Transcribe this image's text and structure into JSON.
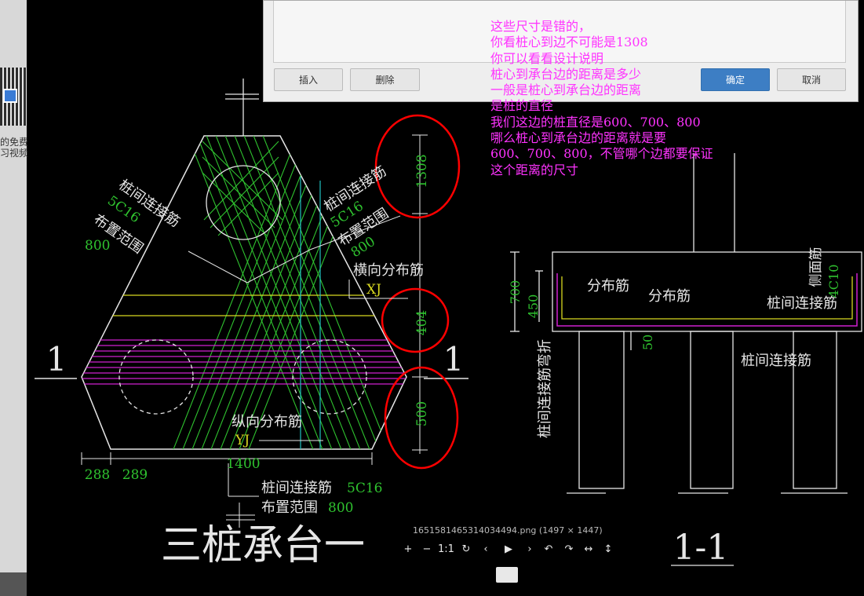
{
  "left_panel": {
    "line1": "的免费",
    "line2": "习视频"
  },
  "dialog": {
    "insert_label": "插入",
    "delete_label": "删除",
    "ok_label": "确定",
    "cancel_label": "取消"
  },
  "note_lines": [
    "这些尺寸是错的，",
    "你看桩心到边不可能是1308",
    "你可以看看设计说明",
    "桩心到承台边的距离是多少",
    "一般是桩心到承台边的距离",
    "是桩的直径",
    "我们这边的桩直径是600、700、800",
    "哪么桩心到承台边的距离就是要",
    "600、700、800，不管哪个边都要保证",
    "这个距离的尺寸"
  ],
  "drawing": {
    "title": "三桩承台一",
    "section_mark": "1",
    "section_title": "1-1",
    "dim_1308": "1308",
    "dim_404": "404",
    "dim_500": "500",
    "dim_288": "288",
    "dim_289": "289",
    "dim_1400": "1400",
    "dim_700": "700",
    "dim_450": "450",
    "dim_50": "50",
    "label_left_rebar": "桩间连接筋",
    "label_left_spec": "5C16",
    "label_left_range": "布置范围",
    "label_left_800": "800",
    "label_right_rebar": "桩间连接筋",
    "label_right_spec": "5C16",
    "label_right_range": "布置范围",
    "label_right_800": "800",
    "label_horizontal": "横向分布筋",
    "label_xj": "XJ",
    "label_vertical": "纵向分布筋",
    "label_yj": "YJ",
    "label_bottom_rebar": "桩间连接筋",
    "label_bottom_spec": "5C16",
    "label_bottom_range": "布置范围",
    "label_bottom_800": "800",
    "sec_dist1": "分布筋",
    "sec_dist2": "分布筋",
    "sec_side": "侧面筋",
    "sec_side_spec": "4C10",
    "sec_conn": "桩间连接筋",
    "sec_conn2": "桩间连接筋",
    "sec_bend": "桩间连接筋弯折"
  },
  "viewer": {
    "filename": "1651581465314034494.png (1497 × 1447)",
    "controls": [
      "+",
      "−",
      "1:1",
      "↻",
      "‹",
      "▶",
      "›",
      "↶",
      "↷",
      "↔",
      "↕"
    ]
  },
  "colors": {
    "cad_white": "#e6e6e6",
    "cad_green": "#2fc22f",
    "cad_magenta": "#d020d0",
    "cad_yellow": "#d8d820",
    "cad_cyan": "#20c0c0",
    "annotation_red": "#ff0000",
    "annotation_text": "#ff33ff",
    "primary_button": "#3d7ec4"
  }
}
